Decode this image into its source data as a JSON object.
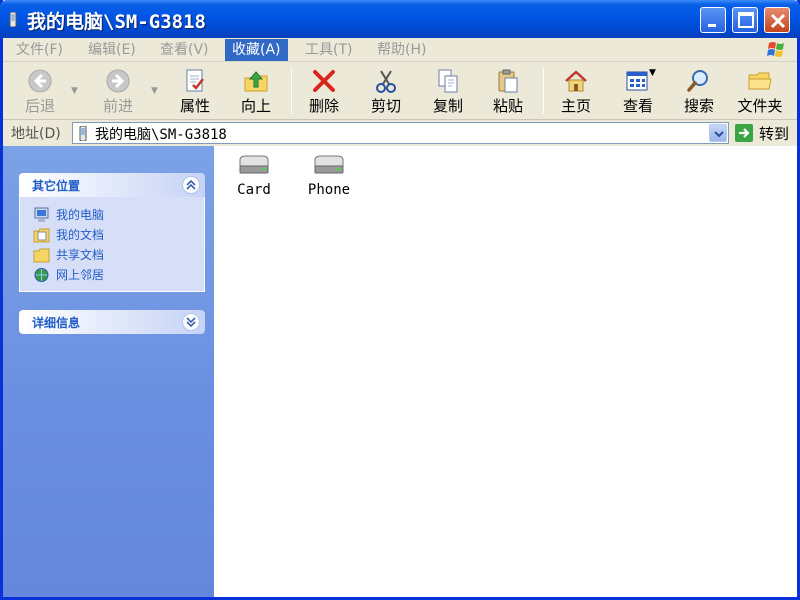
{
  "window": {
    "title": "我的电脑\\SM-G3818"
  },
  "menu": {
    "items": [
      "文件(F)",
      "编辑(E)",
      "查看(V)",
      "收藏(A)",
      "工具(T)",
      "帮助(H)"
    ],
    "active_index": 3
  },
  "toolbar": {
    "back": "后退",
    "forward": "前进",
    "properties": "属性",
    "up": "向上",
    "delete": "删除",
    "cut": "剪切",
    "copy": "复制",
    "paste": "粘贴",
    "home": "主页",
    "view": "查看",
    "search": "搜索",
    "folders": "文件夹"
  },
  "address": {
    "label": "地址(D)",
    "value": "我的电脑\\SM-G3818",
    "go_label": "转到"
  },
  "sidebar": {
    "other_places": {
      "title": "其它位置",
      "items": [
        "我的电脑",
        "我的文档",
        "共享文档",
        "网上邻居"
      ]
    },
    "details": {
      "title": "详细信息"
    }
  },
  "content": {
    "drives": [
      {
        "label": "Card"
      },
      {
        "label": "Phone"
      }
    ]
  },
  "colors": {
    "titlebar": "#0055e5",
    "menu_active": "#316ac5",
    "sidebar": "#6a8ee0",
    "task_link": "#215dc6"
  }
}
